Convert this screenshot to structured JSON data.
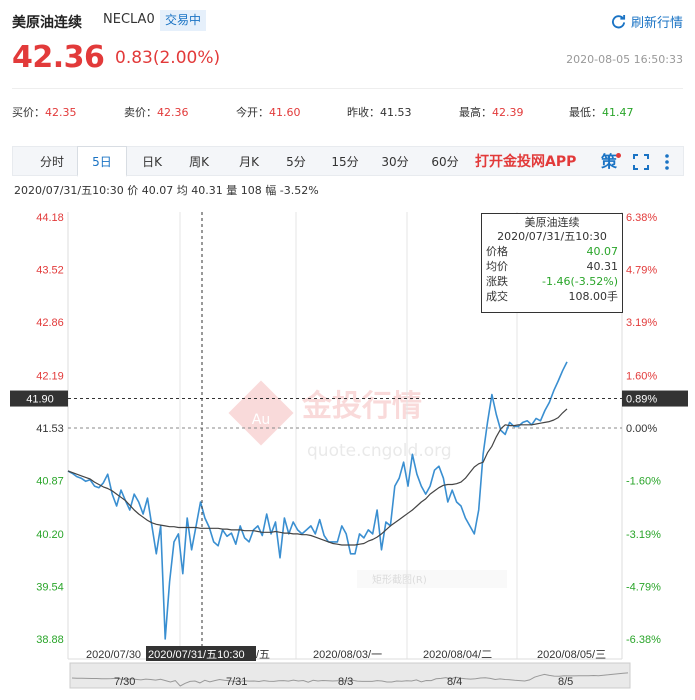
{
  "header": {
    "title": "美原油连续",
    "code": "NECLA0",
    "status": "交易中",
    "refresh_label": "刷新行情",
    "price": "42.36",
    "change": "0.83(2.00%)",
    "timestamp": "2020-08-05 16:50:33"
  },
  "quotes": [
    {
      "label": "买价：",
      "value": "42.35",
      "tone": "up"
    },
    {
      "label": "卖价：",
      "value": "42.36",
      "tone": "up"
    },
    {
      "label": "今开：",
      "value": "41.60",
      "tone": "up"
    },
    {
      "label": "昨收：",
      "value": "41.53",
      "tone": "neutral"
    },
    {
      "label": "最高：",
      "value": "42.39",
      "tone": "up"
    },
    {
      "label": "最低：",
      "value": "41.47",
      "tone": "down"
    }
  ],
  "tabs": [
    "分时",
    "5日",
    "日K",
    "周K",
    "月K",
    "5分",
    "15分",
    "30分",
    "60分"
  ],
  "active_tab": "5日",
  "app_link": "打开金投网APP",
  "ce_icon": "策",
  "info_line": "2020/07/31/五10:30  价 40.07  均 40.31  量 108  幅 -3.52%",
  "tooltip": {
    "title": "美原油连续",
    "time": "2020/07/31/五10:30",
    "rows": [
      {
        "label": "价格",
        "value": "40.07"
      },
      {
        "label": "均价",
        "value": "40.31"
      },
      {
        "label": "涨跌",
        "value": "-1.46(-3.52%)"
      },
      {
        "label": "成交",
        "value": "108.00手"
      }
    ]
  },
  "watermark": {
    "brand": "金投行情",
    "url": "quote.cngold.org",
    "symbol": "Au",
    "sub": "矩形截图(R)"
  },
  "colors": {
    "up": "#e23a3a",
    "down": "#2aa52a",
    "accent": "#1a73c4",
    "price_line": "#3a8fd1",
    "avg_line": "#444444"
  },
  "chart_data": {
    "type": "line",
    "prev_close": 41.53,
    "ylim": [
      38.88,
      44.18
    ],
    "y_ticks": [
      {
        "price": "44.18",
        "pct": "6.38%"
      },
      {
        "price": "43.52",
        "pct": "4.79%"
      },
      {
        "price": "42.86",
        "pct": "3.19%"
      },
      {
        "price": "42.19",
        "pct": "1.60%"
      },
      {
        "price": "41.53",
        "pct": "0.00%"
      },
      {
        "price": "40.87",
        "pct": "-1.60%"
      },
      {
        "price": "40.20",
        "pct": "-3.19%"
      },
      {
        "price": "39.54",
        "pct": "-4.79%"
      },
      {
        "price": "38.88",
        "pct": "-6.38%"
      }
    ],
    "crosshair": {
      "price": "41.90",
      "pct": "0.89%"
    },
    "x_labels": [
      "2020/07/30",
      "2020/07/31/五10:30",
      "/五",
      "2020/08/03/一",
      "2020/08/04/二",
      "2020/08/05/三"
    ],
    "nav_labels": [
      "7/30",
      "7/31",
      "8/3",
      "8/4",
      "8/5"
    ],
    "series": [
      {
        "role": "price",
        "points": [
          40.99,
          40.96,
          40.92,
          40.9,
          40.86,
          40.88,
          40.8,
          40.78,
          40.84,
          40.95,
          40.7,
          40.55,
          40.75,
          40.62,
          40.5,
          40.7,
          40.6,
          40.45,
          40.65,
          40.3,
          39.95,
          40.3,
          38.88,
          39.6,
          40.1,
          40.2,
          39.7,
          40.4,
          40.0,
          40.3,
          40.6,
          40.4,
          40.28,
          40.1,
          40.05,
          40.25,
          40.17,
          40.21,
          40.07,
          40.3,
          40.15,
          40.1,
          40.25,
          40.3,
          40.18,
          40.45,
          40.2,
          40.35,
          39.9,
          40.4,
          40.2,
          40.35,
          40.25,
          40.2,
          40.25,
          40.3,
          40.2,
          40.38,
          40.18,
          40.1,
          40.1,
          40.1,
          40.3,
          40.2,
          39.95,
          39.95,
          40.2,
          40.15,
          40.25,
          40.2,
          40.5,
          40.0,
          40.35,
          40.3,
          40.8,
          40.9,
          41.1,
          40.8,
          41.2,
          40.95,
          40.8,
          40.7,
          40.8,
          41.0,
          41.05,
          40.9,
          40.6,
          40.75,
          40.6,
          40.55,
          40.4,
          40.3,
          40.2,
          40.5,
          41.2,
          41.6,
          41.95,
          41.7,
          41.5,
          41.45,
          41.6,
          41.55,
          41.55,
          41.6,
          41.62,
          41.57,
          41.65,
          41.62,
          41.75,
          41.85,
          42.0,
          42.12,
          42.25,
          42.36
        ]
      },
      {
        "role": "average",
        "points": [
          40.99,
          40.97,
          40.95,
          40.93,
          40.91,
          40.89,
          40.85,
          40.82,
          40.79,
          40.77,
          40.74,
          40.7,
          40.66,
          40.62,
          40.56,
          40.5,
          40.45,
          40.41,
          40.37,
          40.34,
          40.32,
          40.31,
          40.3,
          40.29,
          40.29,
          40.28,
          40.28,
          40.28,
          40.28,
          40.28,
          40.27,
          40.27,
          40.27,
          40.27,
          40.27,
          40.26,
          40.26,
          40.25,
          40.25,
          40.25,
          40.24,
          40.24,
          40.24,
          40.23,
          40.22,
          40.22,
          40.22,
          40.23,
          40.22,
          40.21,
          40.21,
          40.2,
          40.2,
          40.19,
          40.19,
          40.18,
          40.16,
          40.14,
          40.12,
          40.1,
          40.08,
          40.07,
          40.06,
          40.06,
          40.06,
          40.06,
          40.07,
          40.08,
          40.11,
          40.13,
          40.16,
          40.2,
          40.25,
          40.3,
          40.34,
          40.38,
          40.42,
          40.46,
          40.5,
          40.55,
          40.6,
          40.64,
          40.7,
          40.74,
          40.78,
          40.81,
          40.82,
          40.82,
          40.83,
          40.85,
          40.9,
          40.97,
          41.04,
          41.08,
          41.1,
          41.22,
          41.3,
          41.42,
          41.52,
          41.57,
          41.56,
          41.56,
          41.57,
          41.57,
          41.57,
          41.57,
          41.58,
          41.59,
          41.6,
          41.61,
          41.63,
          41.66,
          41.72,
          41.77
        ]
      }
    ]
  }
}
